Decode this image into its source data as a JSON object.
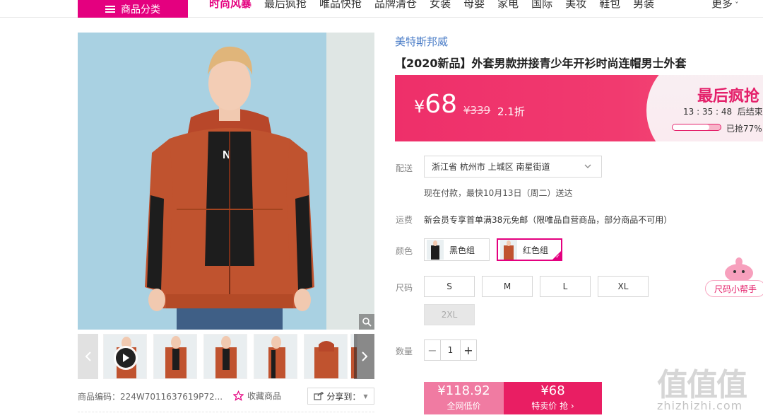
{
  "nav": {
    "category_button": "商品分类",
    "items": [
      "时尚风暴",
      "最后疯抢",
      "唯品快抢",
      "品牌清仓",
      "女装",
      "母婴",
      "家电",
      "国际",
      "美妆",
      "鞋包",
      "男装"
    ],
    "more": "更多"
  },
  "product": {
    "brand": "美特斯邦威",
    "title": "【2020新品】外套男款拼接青少年开衫时尚连帽男士外套",
    "price_symbol": "¥",
    "price": "68",
    "original_price": "¥339",
    "discount": "2.1折",
    "flash_sale_title": "最后疯抢",
    "countdown": "13 : 35 : 48",
    "countdown_suffix": "后结束",
    "sold_percent_label": "已抢77%",
    "sold_fraction": 0.77,
    "item_code": "商品编码：224W7011637619P72...",
    "favorite_label": "收藏商品",
    "share_label": "分享到："
  },
  "delivery": {
    "label": "配送",
    "address": "浙江省 杭州市 上城区 南星街道",
    "note": "现在付款，最快10月13日（周二）送达"
  },
  "freight": {
    "label": "运费",
    "text": "新会员专享首单满38元免邮（限唯品自营商品，部分商品不可用）"
  },
  "color": {
    "label": "颜色",
    "options": [
      "黑色组",
      "红色组"
    ],
    "selected": "红色组"
  },
  "size": {
    "label": "尺码",
    "options": [
      "S",
      "M",
      "L",
      "XL",
      "2XL"
    ],
    "disabled": [
      "2XL"
    ]
  },
  "quantity": {
    "label": "数量",
    "value": "1"
  },
  "buy": {
    "orig_price": "¥118.92",
    "orig_label": "全网低价",
    "sale_price": "¥68",
    "sale_label": "特卖价 抢"
  },
  "helper": {
    "label": "尺码小帮手"
  },
  "watermark": {
    "chars": "值值值",
    "url": "zhizhizhi.com"
  },
  "colors": {
    "accent": "#e4007f",
    "price_bar": "#ee2f6a",
    "brand_link": "#4a7cc7"
  }
}
